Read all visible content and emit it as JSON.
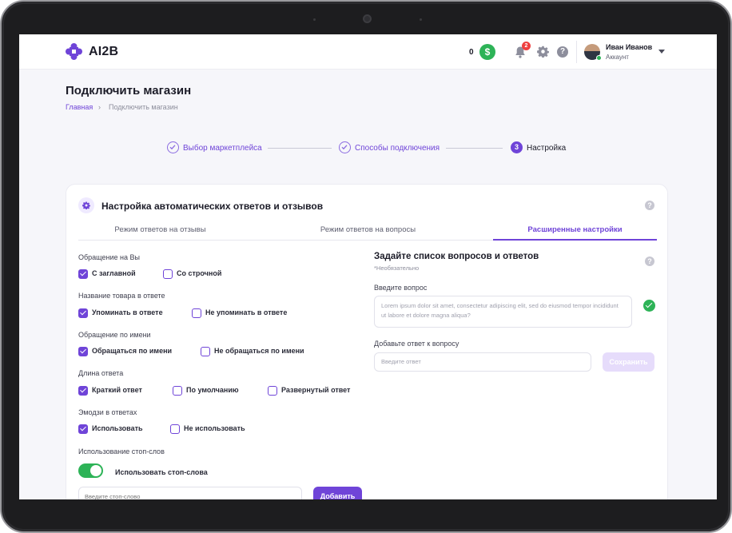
{
  "brand": {
    "name": "AI2B",
    "accent": "#6f44d8",
    "success": "#2db357"
  },
  "header": {
    "balance": "0",
    "currency_symbol": "$",
    "notifications_count": "2",
    "user_name": "Иван Иванов",
    "user_role": "Аккаунт"
  },
  "page": {
    "title": "Подключить магазин",
    "breadcrumb_home": "Главная",
    "breadcrumb_sep": "›",
    "breadcrumb_current": "Подключить магазин"
  },
  "stepper": {
    "steps": [
      {
        "label": "Выбор маркетплейса",
        "status": "done"
      },
      {
        "label": "Способы подключения",
        "status": "done"
      },
      {
        "label": "Настройка",
        "number": "3",
        "status": "current"
      }
    ]
  },
  "card": {
    "title": "Настройка автоматических ответов и отзывов",
    "help": "?",
    "tabs": [
      {
        "label": "Режим ответов на отзывы",
        "active": false
      },
      {
        "label": "Режим ответов на вопросы",
        "active": false
      },
      {
        "label": "Расширенные настройки",
        "active": true
      }
    ]
  },
  "settings": {
    "groups": [
      {
        "label": "Обращение на Вы",
        "options": [
          {
            "label": "С заглавной",
            "checked": true
          },
          {
            "label": "Со строчной",
            "checked": false
          }
        ]
      },
      {
        "label": "Название товара в ответе",
        "options": [
          {
            "label": "Упоминать в ответе",
            "checked": true
          },
          {
            "label": "Не упоминать в ответе",
            "checked": false
          }
        ]
      },
      {
        "label": "Обращение по имени",
        "options": [
          {
            "label": "Обращаться по имени",
            "checked": true
          },
          {
            "label": "Не обращаться по имени",
            "checked": false
          }
        ]
      },
      {
        "label": "Длина ответа",
        "options": [
          {
            "label": "Краткий ответ",
            "checked": true
          },
          {
            "label": "По умолчанию",
            "checked": false
          },
          {
            "label": "Развернутый ответ",
            "checked": false
          }
        ]
      },
      {
        "label": "Эмодзи в ответах",
        "options": [
          {
            "label": "Использовать",
            "checked": true
          },
          {
            "label": "Не использовать",
            "checked": false
          }
        ]
      }
    ],
    "stopwords_group": "Использование стоп-слов",
    "stopwords_toggle_label": "Использовать стоп-слова",
    "stopwords_enabled": true,
    "stopword_placeholder": "Введите стоп-слово",
    "add_button": "Добавить"
  },
  "qa": {
    "title": "Задайте список вопросов и ответов",
    "subtitle": "*Необязательно",
    "question_label": "Введите вопрос",
    "question_value": "Lorem ipsum dolor sit amet, consectetur adipiscing elit, sed do eiusmod tempor incididunt ut labore et dolore magna aliqua?",
    "answer_label": "Добавьте ответ к вопросу",
    "answer_placeholder": "Введите ответ",
    "save_button": "Сохранить"
  }
}
